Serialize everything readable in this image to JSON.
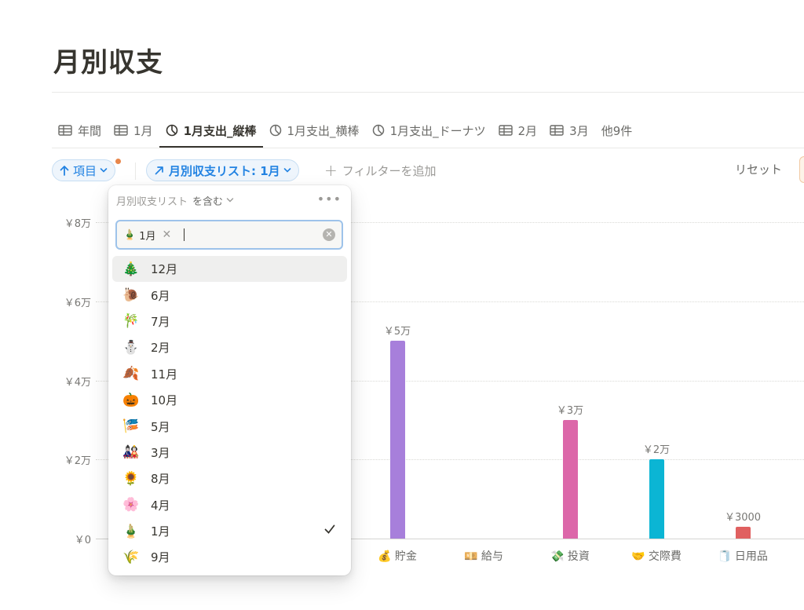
{
  "title": "月別収支",
  "tabs": [
    {
      "label": "年間",
      "icon": "table-icon",
      "active": false
    },
    {
      "label": "1月",
      "icon": "table-icon",
      "active": false
    },
    {
      "label": "1月支出_縦棒",
      "icon": "chart-icon",
      "active": true
    },
    {
      "label": "1月支出_横棒",
      "icon": "chart-icon",
      "active": false
    },
    {
      "label": "1月支出_ドーナツ",
      "icon": "chart-icon",
      "active": false
    },
    {
      "label": "2月",
      "icon": "table-icon",
      "active": false
    },
    {
      "label": "3月",
      "icon": "table-icon",
      "active": false
    },
    {
      "label": "他9件",
      "icon": "",
      "active": false
    }
  ],
  "toolbar": {
    "sort_label": "項目",
    "filter_label": "月別収支リスト: 1月",
    "add_filter_label": "フィルターを追加",
    "reset_label": "リセット",
    "accent": "#2383e2"
  },
  "dropdown": {
    "property": "月別収支リスト",
    "operator": "を含む",
    "token_label": "1月",
    "token_emoji": "🎍",
    "options": [
      {
        "emoji": "🎄",
        "label": "12月",
        "checked": false
      },
      {
        "emoji": "🐌",
        "label": "6月",
        "checked": false
      },
      {
        "emoji": "🎋",
        "label": "7月",
        "checked": false
      },
      {
        "emoji": "⛄",
        "label": "2月",
        "checked": false
      },
      {
        "emoji": "🍂",
        "label": "11月",
        "checked": false
      },
      {
        "emoji": "🎃",
        "label": "10月",
        "checked": false
      },
      {
        "emoji": "🎏",
        "label": "5月",
        "checked": false
      },
      {
        "emoji": "🎎",
        "label": "3月",
        "checked": false
      },
      {
        "emoji": "🌻",
        "label": "8月",
        "checked": false
      },
      {
        "emoji": "🌸",
        "label": "4月",
        "checked": false
      },
      {
        "emoji": "🎍",
        "label": "1月",
        "checked": true
      },
      {
        "emoji": "🌾",
        "label": "9月",
        "checked": false
      }
    ]
  },
  "chart_data": {
    "type": "bar",
    "title": "",
    "xlabel": "",
    "ylabel": "",
    "ylim": [
      0,
      80000
    ],
    "yticks": [
      0,
      20000,
      40000,
      60000,
      80000
    ],
    "ytick_labels": [
      "￥0",
      "￥2万",
      "￥4万",
      "￥6万",
      "￥8万"
    ],
    "grid": true,
    "categories": [
      "💰 貯金",
      "💴 給与",
      "💸 投資",
      "🤝 交際費",
      "🧻 日用品"
    ],
    "values": [
      50000,
      0,
      30000,
      20000,
      3000
    ],
    "data_labels": [
      "￥5万",
      "",
      "￥3万",
      "￥2万",
      "￥3000"
    ],
    "colors": [
      "#a77fdb",
      "#c4c4c4",
      "#dc67a9",
      "#0bb5d4",
      "#e06060"
    ]
  }
}
